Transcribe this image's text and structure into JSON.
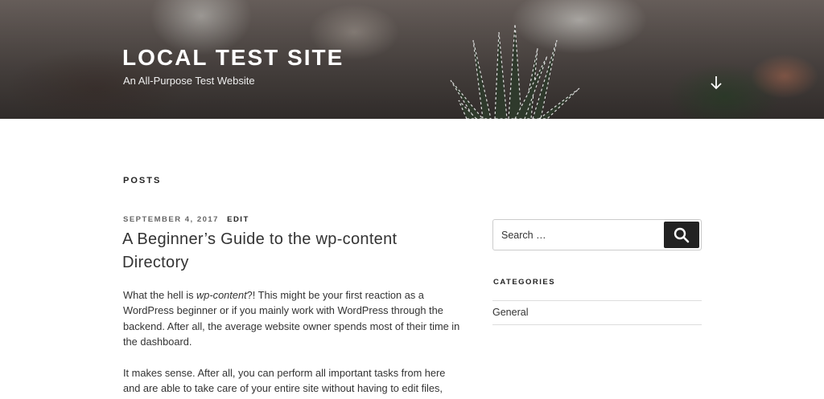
{
  "header": {
    "title": "LOCAL TEST SITE",
    "description": "An All-Purpose Test Website",
    "scroll_icon": "arrow-down-icon"
  },
  "main": {
    "heading": "POSTS",
    "post": {
      "date": "SEPTEMBER 4, 2017",
      "edit_label": "EDIT",
      "title": "A Beginner’s Guide to the wp-content Directory",
      "paragraphs": [
        {
          "before": "What the hell is ",
          "em": "wp-content",
          "after": "?! This might be your first reaction as a WordPress beginner or if you mainly work with WordPress through the backend. After all, the average website owner spends most of their time in the dashboard."
        },
        {
          "before": "It makes sense. After all, you can perform all important tasks from here and are able to take care of your entire site without having to edit files,",
          "em": "",
          "after": ""
        }
      ]
    }
  },
  "sidebar": {
    "search": {
      "placeholder": "Search …",
      "button_icon": "search-icon"
    },
    "categories_title": "CATEGORIES",
    "categories": [
      "General"
    ]
  },
  "colors": {
    "button_bg": "#222222",
    "text": "#333333",
    "white": "#ffffff"
  }
}
